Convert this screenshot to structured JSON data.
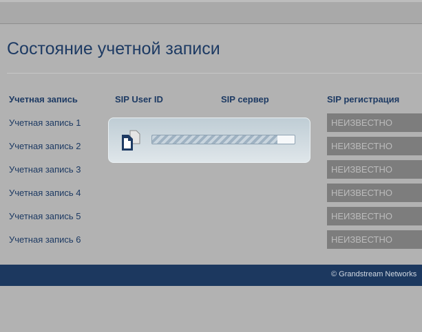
{
  "page": {
    "title": "Состояние учетной записи"
  },
  "table": {
    "headers": {
      "account": "Учетная запись",
      "user_id": "SIP User ID",
      "server": "SIP сервер",
      "registration": "SIP регистрация"
    },
    "rows": [
      {
        "account": "Учетная запись 1",
        "status": "НЕИЗВЕСТНО"
      },
      {
        "account": "Учетная запись 2",
        "status": "НЕИЗВЕСТНО"
      },
      {
        "account": "Учетная запись 3",
        "status": "НЕИЗВЕСТНО"
      },
      {
        "account": "Учетная запись 4",
        "status": "НЕИЗВЕСТНО"
      },
      {
        "account": "Учетная запись 5",
        "status": "НЕИЗВЕСТНО"
      },
      {
        "account": "Учетная запись 6",
        "status": "НЕИЗВЕСТНО"
      }
    ]
  },
  "loading": {
    "icon": "document-copy-icon",
    "progress": 0.88
  },
  "footer": {
    "copyright": "© Grandstream Networks"
  },
  "colors": {
    "accent": "#1d3a63",
    "footer_bg": "#1c385f",
    "status_bg": "#7d7d7d",
    "page_bg": "#b2b2b2"
  }
}
